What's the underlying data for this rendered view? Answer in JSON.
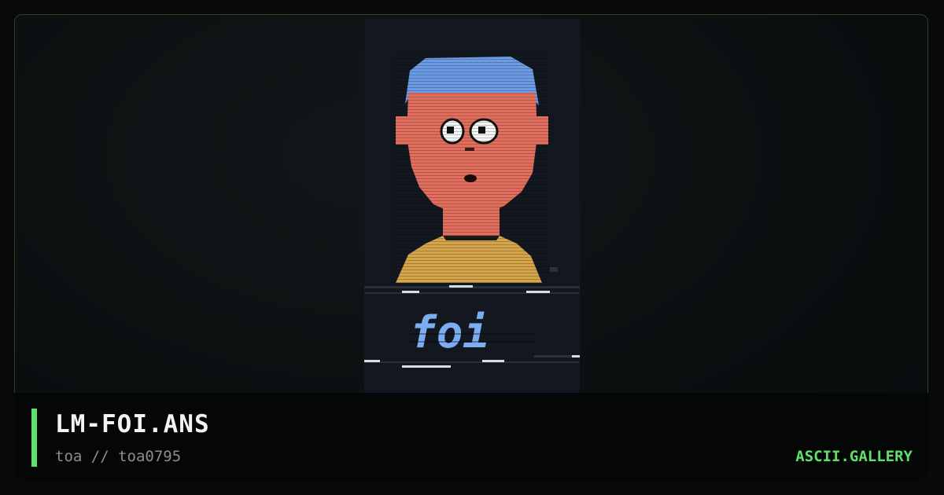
{
  "artwork": {
    "title": "LM-FOI.ANS",
    "author_line": "toa // toa0795",
    "art_text": "foi",
    "colors": {
      "hair": "#6a9be3",
      "skin": "#e26e5e",
      "shirt": "#d6a44a",
      "text": "#7cadf2"
    }
  },
  "site": {
    "name": "ASCII.GALLERY",
    "accent_color": "#5fe06a"
  }
}
